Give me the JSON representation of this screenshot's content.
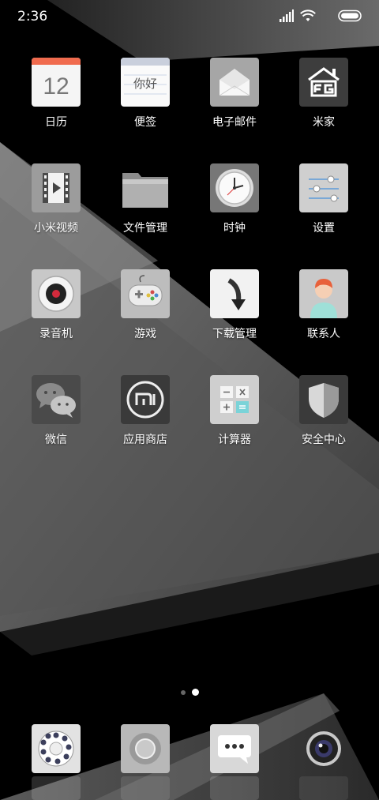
{
  "status_bar": {
    "time": "2:36"
  },
  "apps": [
    {
      "label": "日历",
      "icon": "calendar-icon",
      "day": "12"
    },
    {
      "label": "便签",
      "icon": "notes-icon",
      "text": "你好"
    },
    {
      "label": "电子邮件",
      "icon": "email-icon"
    },
    {
      "label": "米家",
      "icon": "mijia-home-icon"
    },
    {
      "label": "小米视频",
      "icon": "video-icon"
    },
    {
      "label": "文件管理",
      "icon": "folder-icon"
    },
    {
      "label": "时钟",
      "icon": "clock-icon"
    },
    {
      "label": "设置",
      "icon": "settings-sliders-icon"
    },
    {
      "label": "录音机",
      "icon": "recorder-icon"
    },
    {
      "label": "游戏",
      "icon": "gamepad-icon"
    },
    {
      "label": "下载管理",
      "icon": "download-arrow-icon"
    },
    {
      "label": "联系人",
      "icon": "contact-person-icon"
    },
    {
      "label": "微信",
      "icon": "wechat-icon"
    },
    {
      "label": "应用商店",
      "icon": "mi-store-icon"
    },
    {
      "label": "计算器",
      "icon": "calculator-icon"
    },
    {
      "label": "安全中心",
      "icon": "security-shield-icon"
    }
  ],
  "page_indicator": {
    "pages": 2,
    "current": 2
  },
  "dock": [
    {
      "icon": "phone-rotary-dial-icon"
    },
    {
      "icon": "browser-circle-icon"
    },
    {
      "icon": "messages-bubble-icon"
    },
    {
      "icon": "camera-lens-icon"
    }
  ]
}
